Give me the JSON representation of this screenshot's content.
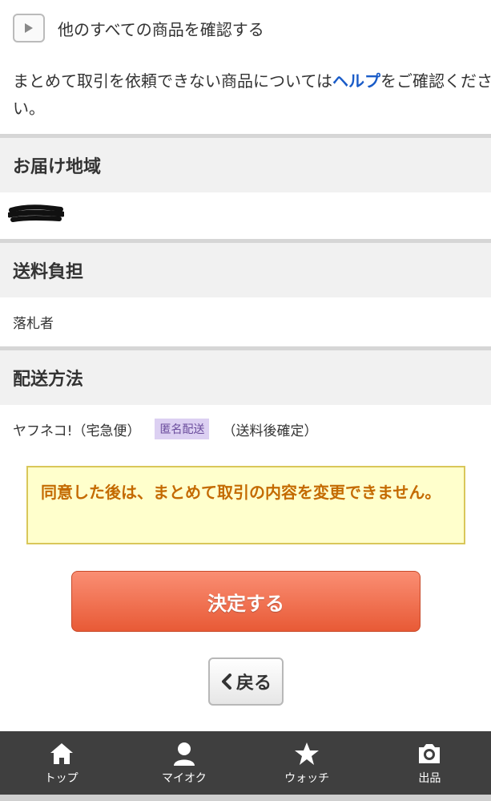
{
  "see_all": {
    "label": "他のすべての商品を確認する",
    "icon": "play-icon"
  },
  "note": {
    "before": "まとめて取引を依頼できない商品については",
    "link": "ヘルプ",
    "after": "をご確認ください。"
  },
  "delivery_area": {
    "header": "お届け地域",
    "value_redacted": true
  },
  "shipping_cost": {
    "header": "送料負担",
    "value": "落札者"
  },
  "shipping_method": {
    "header": "配送方法",
    "method": "ヤフネコ!（宅急便）",
    "badge": "匿名配送",
    "cost_note": "（送料後確定）"
  },
  "warning": {
    "text": "同意した後は、まとめて取引の内容を変更できません。"
  },
  "actions": {
    "decide": "決定する",
    "back": "戻る"
  },
  "tabs": [
    {
      "label": "トップ",
      "icon": "home-icon"
    },
    {
      "label": "マイオク",
      "icon": "user-icon"
    },
    {
      "label": "ウォッチ",
      "icon": "star-icon"
    },
    {
      "label": "出品",
      "icon": "camera-icon"
    }
  ],
  "colors": {
    "link": "#1a5cc8",
    "accent": "#e85a36",
    "warning_text": "#c46a00",
    "tabbar": "#3f3f3f"
  }
}
